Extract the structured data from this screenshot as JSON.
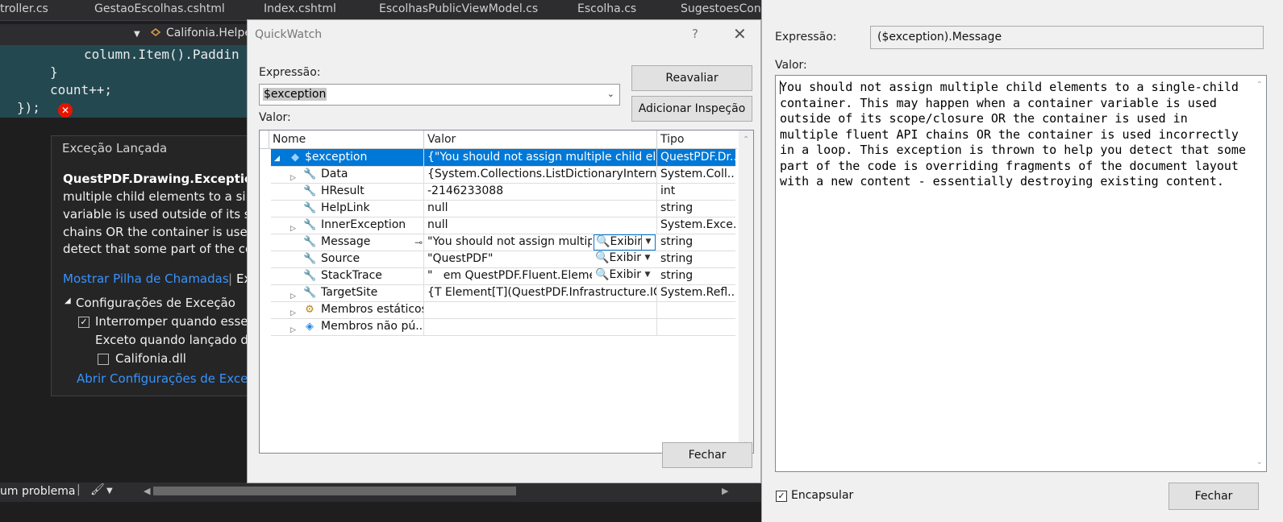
{
  "ide": {
    "tabs": [
      "troller.cs",
      "GestaoEscolhas.cshtml",
      "Index.cshtml",
      "EscolhasPublicViewModel.cs",
      "Escolha.cs",
      "SugestoesCont"
    ],
    "nav_class": "Califonia.Helpe",
    "code_lines": [
      "column.Item().Paddin",
      "}",
      "count++;",
      "});"
    ],
    "status_text": "um problema"
  },
  "exception_popup": {
    "title": "Exceção Lançada",
    "heading": "QuestPDF.Drawing.Exceptions",
    "lines": [
      "multiple child elements to a sing",
      "variable is used outside of its sco",
      "chains OR the container is used",
      "detect that some part of the coc"
    ],
    "call_stack_link": "Mostrar Pilha de Chamadas",
    "separator": "|",
    "extra": "Ex",
    "settings_header": "Configurações de Exceção",
    "break_option": "Interromper quando esse t",
    "except_when": "Exceto quando lançado de",
    "dll_option": "Califonia.dll",
    "open_settings_link": "Abrir Configurações de Exceçõ"
  },
  "quickwatch": {
    "title": "QuickWatch",
    "help_glyph": "?",
    "close_glyph": "✕",
    "expression_label": "Expressão:",
    "expression_value": "$exception",
    "reevaluate_button": "Reavaliar",
    "add_watch_button": "Adicionar Inspeção",
    "value_label": "Valor:",
    "columns": [
      "Nome",
      "Valor",
      "Tipo"
    ],
    "rows": [
      {
        "name": "$exception",
        "value": "{\"You should not assign multiple child ele...",
        "type": "QuestPDF.Dr..."
      },
      {
        "name": "Data",
        "value": "{System.Collections.ListDictionaryInternal}",
        "type": "System.Coll..."
      },
      {
        "name": "HResult",
        "value": "-2146233088",
        "type": "int"
      },
      {
        "name": "HelpLink",
        "value": "null",
        "type": "string"
      },
      {
        "name": "InnerException",
        "value": "null",
        "type": "System.Exce..."
      },
      {
        "name": "Message",
        "value": "\"You should not assign multipl...",
        "type": "string"
      },
      {
        "name": "Source",
        "value": "\"QuestPDF\"",
        "type": "string"
      },
      {
        "name": "StackTrace",
        "value": "\"   em QuestPDF.Fluent.Eleme...",
        "type": "string"
      },
      {
        "name": "TargetSite",
        "value": "{T Element[T](QuestPDF.Infrastructure.ICo...",
        "type": "System.Refl..."
      },
      {
        "name": "Membros estáticos",
        "value": "",
        "type": ""
      },
      {
        "name": "Membros não pú...",
        "value": "",
        "type": ""
      }
    ],
    "view_label": "Exibir",
    "close_button": "Fechar"
  },
  "text_visualizer": {
    "expression_label": "Expressão:",
    "expression_value": "($exception).Message",
    "value_label": "Valor:",
    "text": "You should not assign multiple child elements to a single-child container. This may happen when a container variable is used outside of its scope/closure OR the container is used in multiple fluent API chains OR the container is used incorrectly in a loop. This exception is thrown to help you detect that some part of the code is overriding fragments of the document layout with a new content - essentially destroying existing content.",
    "wrap_label": "Encapsular",
    "close_button": "Fechar"
  },
  "colors": {
    "selection": "#0078d7",
    "error": "#e51400",
    "link": "#3794ff",
    "ide_bg": "#1e1e1e"
  }
}
